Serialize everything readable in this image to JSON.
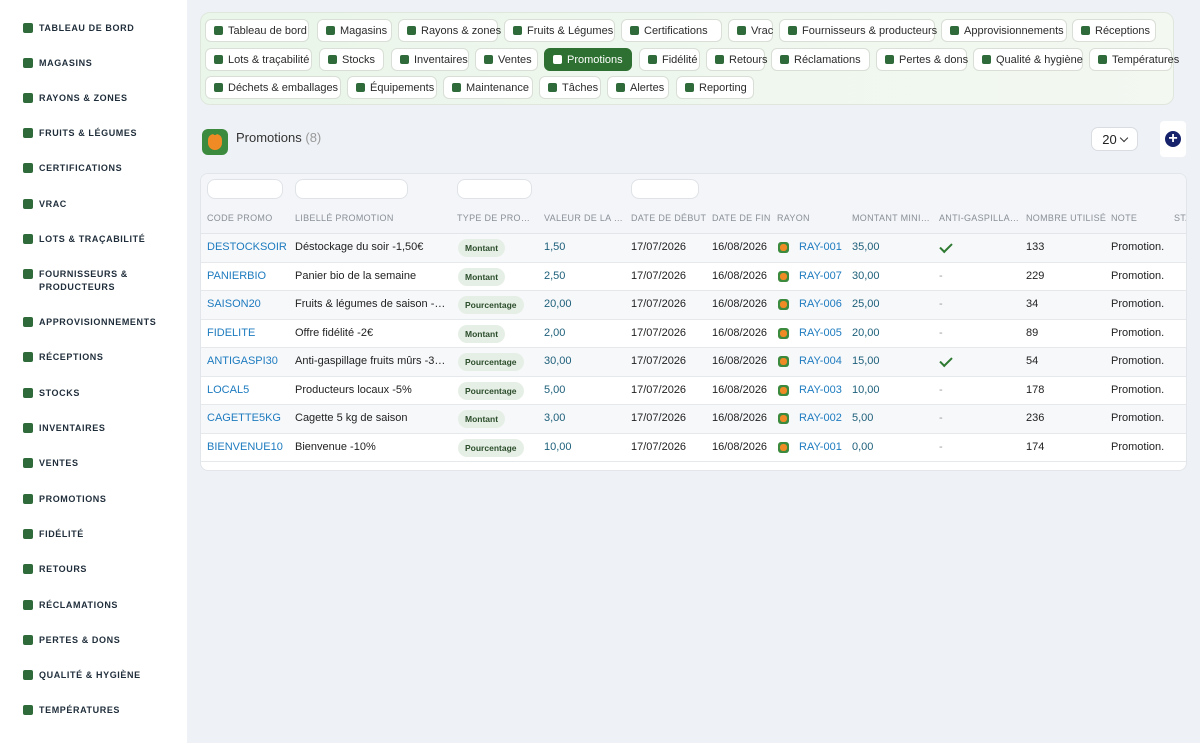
{
  "sidebar": {
    "items": [
      {
        "label": "TABLEAU DE BORD",
        "icon": "leaf-icon"
      },
      {
        "label": "MAGASINS",
        "icon": "store-icon"
      },
      {
        "label": "RAYONS & ZONES",
        "icon": "grid-icon"
      },
      {
        "label": "FRUITS & LÉGUMES",
        "icon": "leaf-icon"
      },
      {
        "label": "CERTIFICATIONS",
        "icon": "certificate-icon"
      },
      {
        "label": "VRAC",
        "icon": "boxes-icon"
      },
      {
        "label": "LOTS & TRAÇABILITÉ",
        "icon": "barcode-icon"
      },
      {
        "label": "FOURNISSEURS & PRODUCTEURS",
        "icon": "tractor-icon"
      },
      {
        "label": "APPROVISIONNEMENTS",
        "icon": "seedling-icon"
      },
      {
        "label": "RÉCEPTIONS",
        "icon": "truck-icon"
      },
      {
        "label": "STOCKS",
        "icon": "warehouse-icon"
      },
      {
        "label": "INVENTAIRES",
        "icon": "clipboard-check-icon"
      },
      {
        "label": "VENTES",
        "icon": "cash-register-icon"
      },
      {
        "label": "PROMOTIONS",
        "icon": "tags-icon"
      },
      {
        "label": "FIDÉLITÉ",
        "icon": "award-icon"
      },
      {
        "label": "RETOURS",
        "icon": "undo-icon"
      },
      {
        "label": "RÉCLAMATIONS",
        "icon": "comment-icon"
      },
      {
        "label": "PERTES & DONS",
        "icon": "trash-icon"
      },
      {
        "label": "QUALITÉ & HYGIÈNE",
        "icon": "clipboard-icon"
      },
      {
        "label": "TEMPÉRATURES",
        "icon": "thermometer-icon"
      }
    ]
  },
  "tabs": [
    {
      "label": "Tableau de bord",
      "icon": "leaf-icon"
    },
    {
      "label": "Magasins",
      "icon": "store-icon"
    },
    {
      "label": "Rayons & zones",
      "icon": "grid-icon"
    },
    {
      "label": "Fruits & Légumes",
      "icon": "leaf-icon"
    },
    {
      "label": "Certifications",
      "icon": "certificate-icon"
    },
    {
      "label": "Vrac",
      "icon": "boxes-icon"
    },
    {
      "label": "Fournisseurs & producteurs",
      "icon": "tractor-icon"
    },
    {
      "label": "Approvisionnements",
      "icon": "seedling-icon"
    },
    {
      "label": "Réceptions",
      "icon": "truck-icon"
    },
    {
      "label": "Lots & traçabilité",
      "icon": "barcode-icon"
    },
    {
      "label": "Stocks",
      "icon": "warehouse-icon"
    },
    {
      "label": "Inventaires",
      "icon": "clipboard-check-icon"
    },
    {
      "label": "Ventes",
      "icon": "cash-register-icon"
    },
    {
      "label": "Promotions",
      "icon": "tags-icon",
      "active": true
    },
    {
      "label": "Fidélité",
      "icon": "award-icon"
    },
    {
      "label": "Retours",
      "icon": "undo-icon"
    },
    {
      "label": "Réclamations",
      "icon": "comment-icon"
    },
    {
      "label": "Pertes & dons",
      "icon": "trash-icon"
    },
    {
      "label": "Qualité & hygiène",
      "icon": "clipboard-icon"
    },
    {
      "label": "Températures",
      "icon": "thermometer-icon"
    },
    {
      "label": "Déchets & emballages",
      "icon": "recycle-icon"
    },
    {
      "label": "Équipements",
      "icon": "tools-icon"
    },
    {
      "label": "Maintenance",
      "icon": "wrench-icon"
    },
    {
      "label": "Tâches",
      "icon": "list-icon"
    },
    {
      "label": "Alertes",
      "icon": "bell-icon"
    },
    {
      "label": "Reporting",
      "icon": "pie-chart-icon"
    }
  ],
  "page": {
    "title": "Promotions",
    "count": "(8)",
    "per_page": "20"
  },
  "columns": [
    "CODE PROMO",
    "LIBELLÉ PROMOTION",
    "TYPE DE PROM…",
    "VALEUR DE LA …",
    "DATE DE DÉBUT",
    "DATE DE FIN",
    "RAYON",
    "MONTANT MINI…",
    "ANTI-GASPILLA…",
    "NOMBRE UTILISÉ",
    "NOTE",
    "STA"
  ],
  "rows": [
    {
      "code": "DESTOCKSOIR",
      "label": "Déstockage du soir -1,50€",
      "type": "Montant",
      "value": "1,50",
      "start": "17/07/2026",
      "end": "16/08/2026",
      "rayon": "RAY-001",
      "min": "35,00",
      "anti": true,
      "used": "133",
      "note": "Promotion."
    },
    {
      "code": "PANIERBIO",
      "label": "Panier bio de la semaine",
      "type": "Montant",
      "value": "2,50",
      "start": "17/07/2026",
      "end": "16/08/2026",
      "rayon": "RAY-007",
      "min": "30,00",
      "anti": false,
      "used": "229",
      "note": "Promotion."
    },
    {
      "code": "SAISON20",
      "label": "Fruits & légumes de saison -2…",
      "type": "Pourcentage",
      "value": "20,00",
      "start": "17/07/2026",
      "end": "16/08/2026",
      "rayon": "RAY-006",
      "min": "25,00",
      "anti": false,
      "used": "34",
      "note": "Promotion."
    },
    {
      "code": "FIDELITE",
      "label": "Offre fidélité -2€",
      "type": "Montant",
      "value": "2,00",
      "start": "17/07/2026",
      "end": "16/08/2026",
      "rayon": "RAY-005",
      "min": "20,00",
      "anti": false,
      "used": "89",
      "note": "Promotion."
    },
    {
      "code": "ANTIGASPI30",
      "label": "Anti-gaspillage fruits mûrs -30%",
      "type": "Pourcentage",
      "value": "30,00",
      "start": "17/07/2026",
      "end": "16/08/2026",
      "rayon": "RAY-004",
      "min": "15,00",
      "anti": true,
      "used": "54",
      "note": "Promotion."
    },
    {
      "code": "LOCAL5",
      "label": "Producteurs locaux -5%",
      "type": "Pourcentage",
      "value": "5,00",
      "start": "17/07/2026",
      "end": "16/08/2026",
      "rayon": "RAY-003",
      "min": "10,00",
      "anti": false,
      "used": "178",
      "note": "Promotion."
    },
    {
      "code": "CAGETTE5KG",
      "label": "Cagette 5 kg de saison",
      "type": "Montant",
      "value": "3,00",
      "start": "17/07/2026",
      "end": "16/08/2026",
      "rayon": "RAY-002",
      "min": "5,00",
      "anti": false,
      "used": "236",
      "note": "Promotion."
    },
    {
      "code": "BIENVENUE10",
      "label": "Bienvenue -10%",
      "type": "Pourcentage",
      "value": "10,00",
      "start": "17/07/2026",
      "end": "16/08/2026",
      "rayon": "RAY-001",
      "min": "0,00",
      "anti": false,
      "used": "174",
      "note": "Promotion."
    }
  ],
  "empty_value": "-"
}
